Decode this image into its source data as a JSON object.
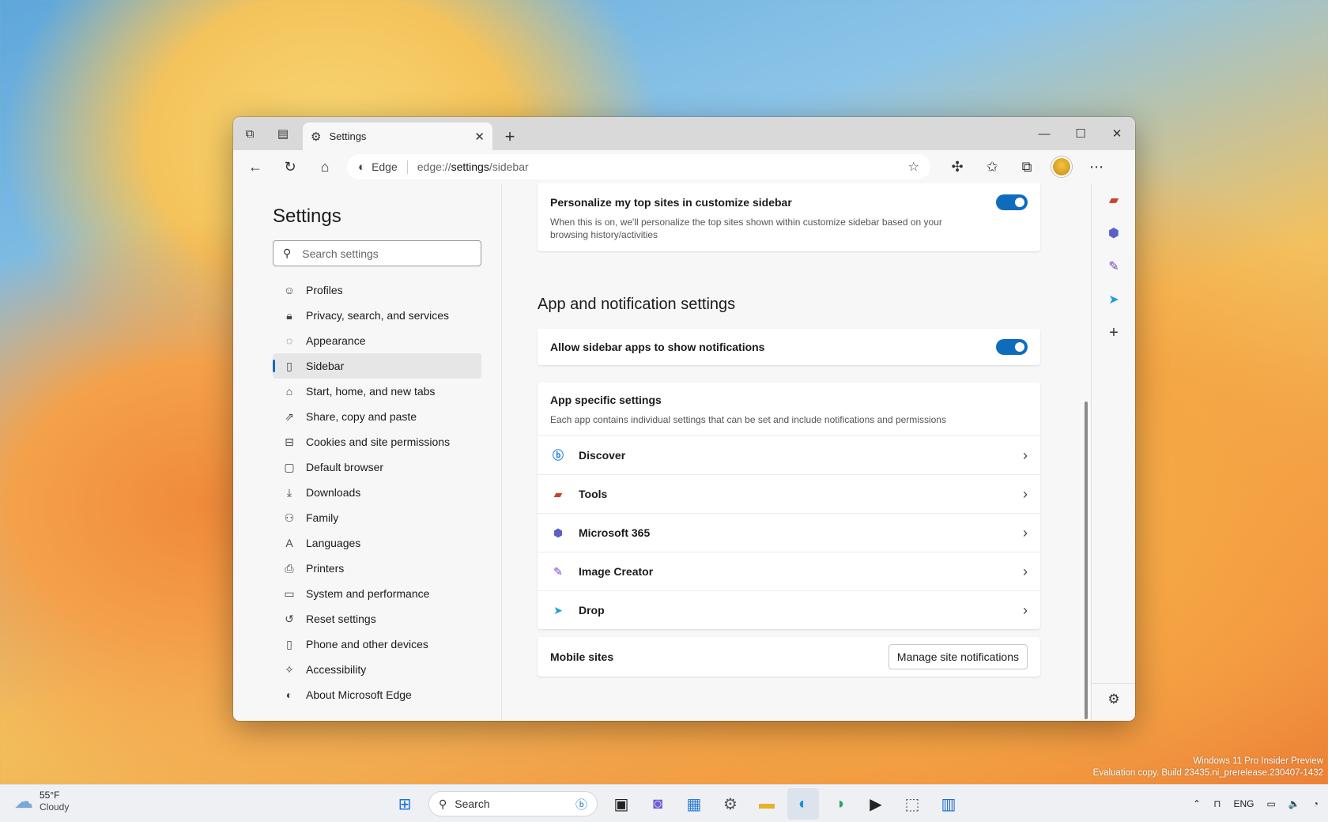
{
  "browser": {
    "tab": {
      "title": "Settings"
    },
    "address": {
      "chip": "Edge",
      "url_prefix": "edge://",
      "url_main": "settings",
      "url_suffix": "/sidebar"
    }
  },
  "settings": {
    "title": "Settings",
    "search_placeholder": "Search settings",
    "nav": [
      {
        "label": "Profiles",
        "icon": "profile-icon"
      },
      {
        "label": "Privacy, search, and services",
        "icon": "lock-icon"
      },
      {
        "label": "Appearance",
        "icon": "appearance-icon"
      },
      {
        "label": "Sidebar",
        "icon": "sidebar-icon",
        "active": true
      },
      {
        "label": "Start, home, and new tabs",
        "icon": "home-icon"
      },
      {
        "label": "Share, copy and paste",
        "icon": "share-icon"
      },
      {
        "label": "Cookies and site permissions",
        "icon": "cookie-icon"
      },
      {
        "label": "Default browser",
        "icon": "browser-icon"
      },
      {
        "label": "Downloads",
        "icon": "download-icon"
      },
      {
        "label": "Family",
        "icon": "family-icon"
      },
      {
        "label": "Languages",
        "icon": "language-icon"
      },
      {
        "label": "Printers",
        "icon": "printer-icon"
      },
      {
        "label": "System and performance",
        "icon": "system-icon"
      },
      {
        "label": "Reset settings",
        "icon": "reset-icon"
      },
      {
        "label": "Phone and other devices",
        "icon": "phone-icon"
      },
      {
        "label": "Accessibility",
        "icon": "accessibility-icon"
      },
      {
        "label": "About Microsoft Edge",
        "icon": "edge-logo-icon"
      }
    ]
  },
  "content": {
    "personalize": {
      "title": "Personalize my top sites in customize sidebar",
      "desc": "When this is on, we'll personalize the top sites shown within customize sidebar based on your browsing history/activities",
      "enabled": true
    },
    "section_heading": "App and notification settings",
    "allow_notifications": {
      "title": "Allow sidebar apps to show notifications",
      "enabled": true
    },
    "app_specific": {
      "title": "App specific settings",
      "desc": "Each app contains individual settings that can be set and include notifications and permissions",
      "apps": [
        {
          "label": "Discover",
          "icon": "discover-icon"
        },
        {
          "label": "Tools",
          "icon": "tools-icon"
        },
        {
          "label": "Microsoft 365",
          "icon": "microsoft365-icon"
        },
        {
          "label": "Image Creator",
          "icon": "image-creator-icon"
        },
        {
          "label": "Drop",
          "icon": "drop-icon"
        }
      ]
    },
    "mobile_sites": {
      "title": "Mobile sites",
      "button": "Manage site notifications"
    }
  },
  "watermark": {
    "line1": "Windows 11 Pro Insider Preview",
    "line2": "Evaluation copy. Build 23435.ni_prerelease.230407-1432"
  },
  "taskbar": {
    "weather_temp": "55°F",
    "weather_desc": "Cloudy",
    "search_label": "Search",
    "tray_lang": "ENG"
  },
  "colors": {
    "accent": "#0f6cbd"
  }
}
